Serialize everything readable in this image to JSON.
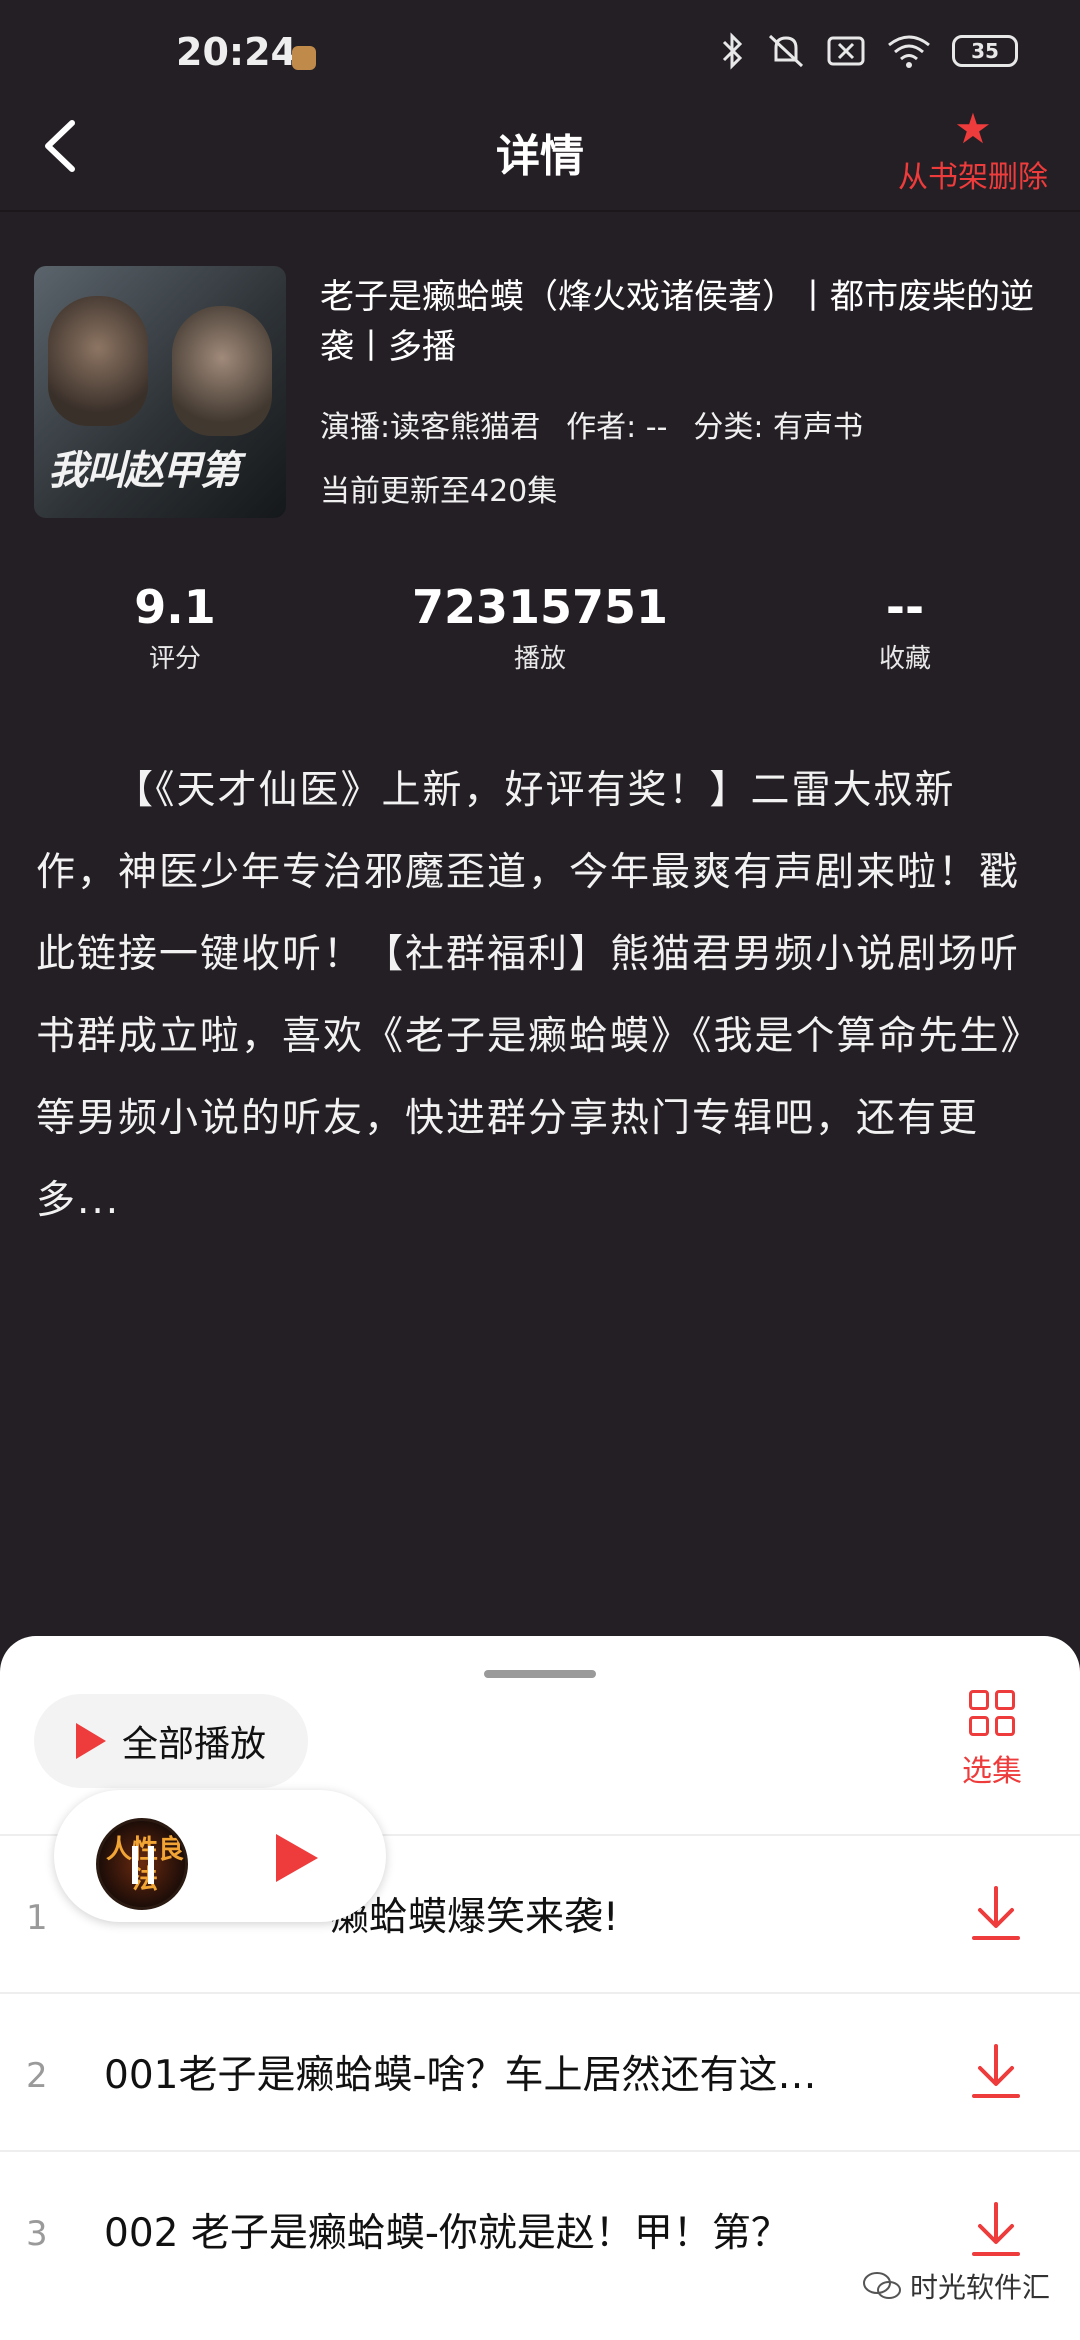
{
  "status_bar": {
    "time": "20:24",
    "battery": "35",
    "icons": [
      "bluetooth-icon",
      "mute-icon",
      "no-sim-icon",
      "wifi-icon",
      "battery-icon"
    ]
  },
  "header": {
    "title": "详情",
    "remove_label": "从书架删除"
  },
  "book": {
    "cover_text": "我叫赵甲第",
    "title": "老子是癞蛤蟆（烽火戏诸侯著）丨都市废柴的逆袭丨多播",
    "narrator": "演播:读客熊猫君",
    "author": "作者: --",
    "category": "分类: 有声书",
    "update": "当前更新至420集"
  },
  "stats": {
    "rating_value": "9.1",
    "rating_label": "评分",
    "plays_value": "72315751",
    "plays_label": "播放",
    "fav_value": "--",
    "fav_label": "收藏"
  },
  "description": "【《天才仙医》上新，好评有奖！】二雷大叔新作，神医少年专治邪魔歪道，今年最爽有声剧来啦！戳此链接一键收听！【社群福利】熊猫君男频小说剧场听书群成立啦，喜欢《老子是癞蛤蟆》《我是个算命先生》等男频小说的听友，快进群分享热门专辑吧，还有更多...",
  "sheet": {
    "play_all_label": "全部播放",
    "select_label": "选集",
    "episodes": [
      {
        "index": "1",
        "title": "癞蛤蟆爆笑来袭!"
      },
      {
        "index": "2",
        "title": "001老子是癞蛤蟆-啥？车上居然还有这…"
      },
      {
        "index": "3",
        "title": "002 老子是癞蛤蟆-你就是赵！甲！第？"
      }
    ]
  },
  "mini_player": {
    "cover_text": "人性良法"
  },
  "watermark": "时光软件汇",
  "colors": {
    "background": "#241f24",
    "accent": "#ee3b3b",
    "sheet": "#ffffff"
  }
}
